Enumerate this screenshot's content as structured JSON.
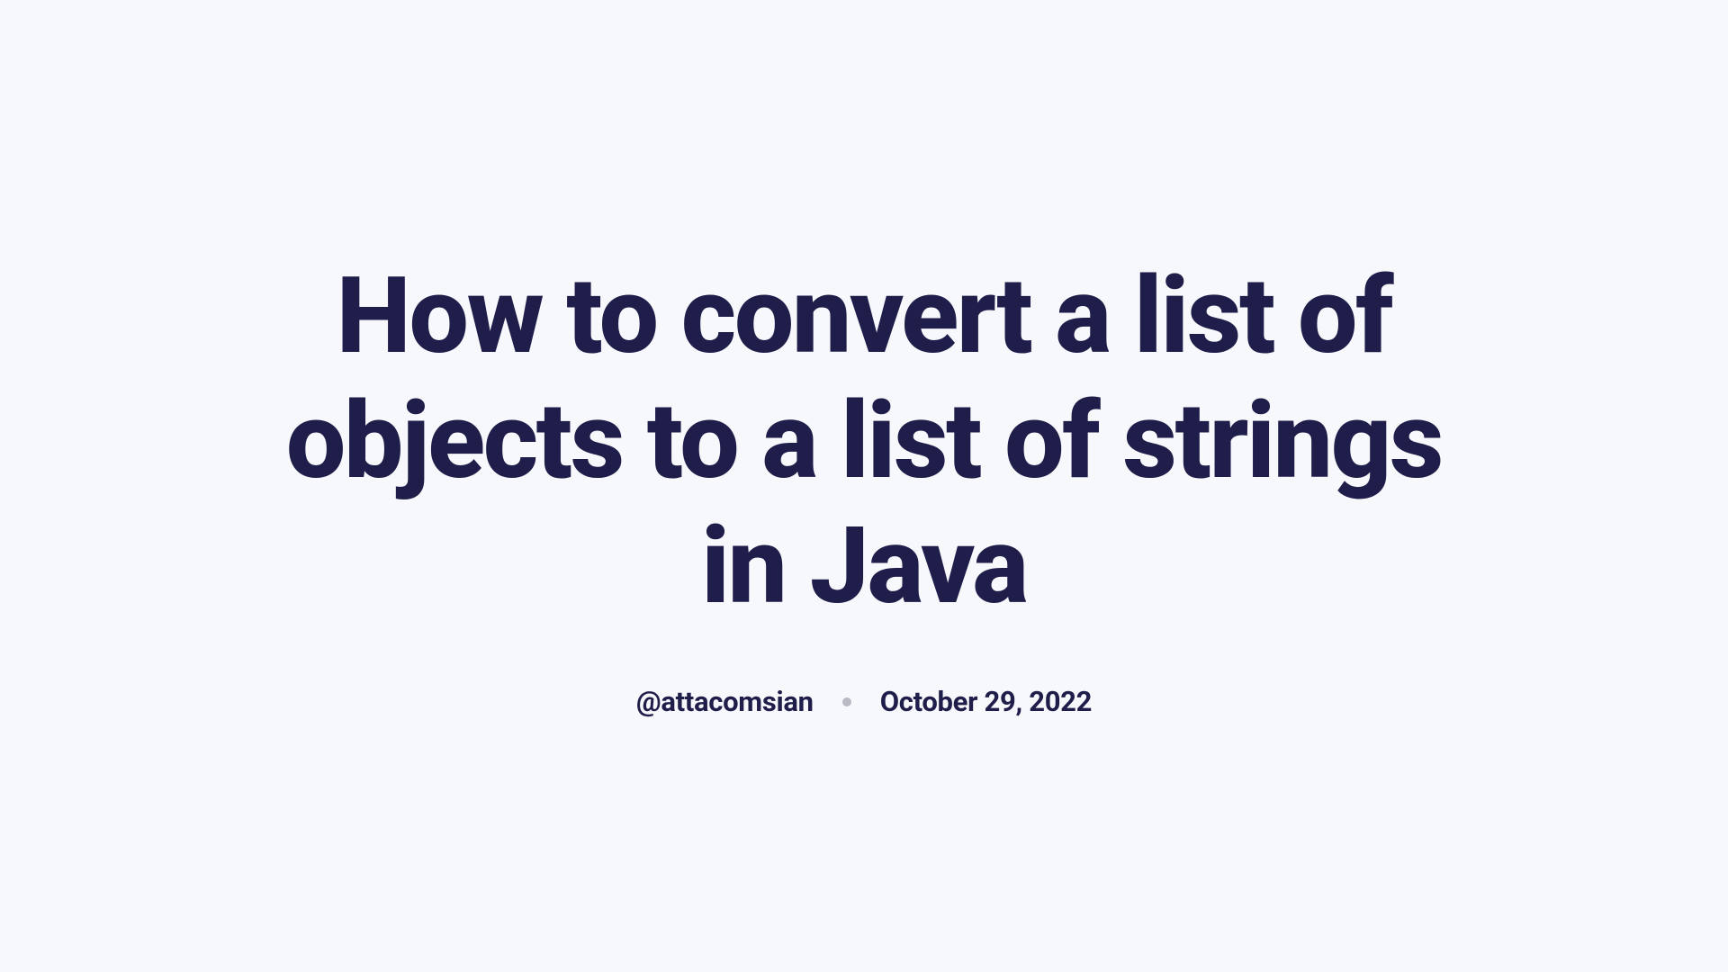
{
  "title": "How to convert a list of objects to a list of strings in Java",
  "author": "@attacomsian",
  "date": "October 29, 2022"
}
